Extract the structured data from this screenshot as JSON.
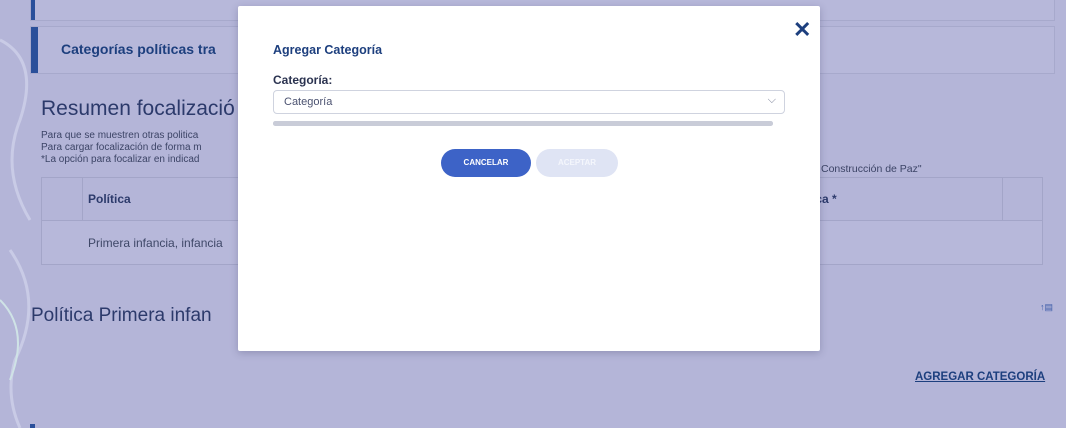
{
  "page": {
    "section_title": "Categorías políticas tra",
    "resumen_heading": "Resumen focalizació",
    "notes": [
      "Para que se muestren otras politica",
      "Para cargar focalización de forma m",
      "*La opción para focalizar en indicad"
    ],
    "note_right": "Construcción de Paz\"",
    "table": {
      "col1_header": "Política",
      "col2_header": "ica *",
      "row1_col1": "Primera infancia, infancia"
    },
    "politica_heading": "Política Primera infan",
    "sort_icon": "sort-icon",
    "agregar_link": "AGREGAR CATEGORÍA"
  },
  "modal": {
    "title": "Agregar Categoría",
    "close_icon": "close-icon",
    "field_label": "Categoría:",
    "select_value": "Categoría",
    "chevron_icon": "chevron-down-icon",
    "cancel_label": "CANCELAR",
    "accept_label": "ACEPTAR"
  },
  "colors": {
    "overlay": "#b4b5d8",
    "primary": "#1d3f7e",
    "button": "#3d63c7",
    "button_disabled": "#dfe4f4"
  }
}
